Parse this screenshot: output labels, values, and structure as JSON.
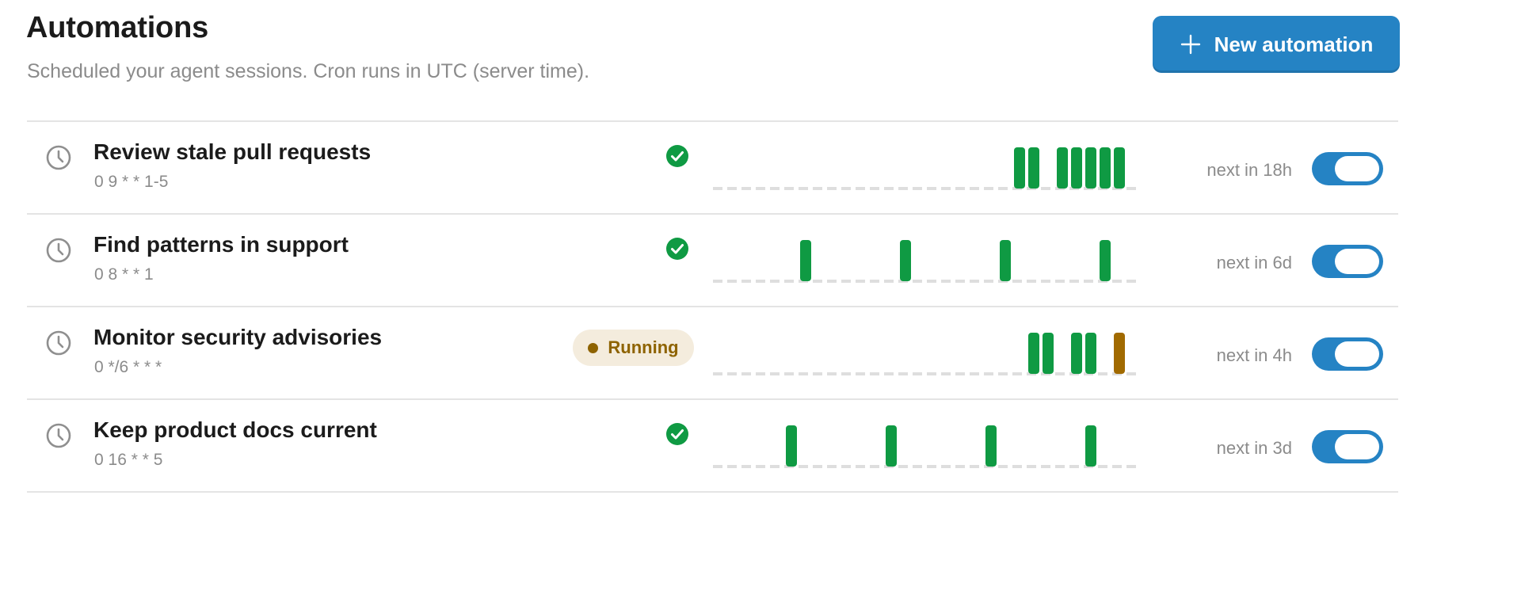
{
  "header": {
    "title": "Automations",
    "subtitle": "Scheduled your agent sessions. Cron runs in UTC (server time).",
    "new_button_label": "New automation"
  },
  "colors": {
    "accent": "#2583c4",
    "success": "#0f9a43",
    "running": "#a16a00",
    "baseline": "#dedede"
  },
  "icons": {
    "row": "clock-icon",
    "status_ok": "check-circle-icon",
    "add": "plus-icon"
  },
  "automations": [
    {
      "name": "Review stale pull requests",
      "cron": "0 9 * * 1-5",
      "status": "success",
      "next_run": "next in 18h",
      "enabled": true,
      "runs": [
        {
          "slot": 21,
          "status": "success"
        },
        {
          "slot": 22,
          "status": "success"
        },
        {
          "slot": 24,
          "status": "success"
        },
        {
          "slot": 25,
          "status": "success"
        },
        {
          "slot": 26,
          "status": "success"
        },
        {
          "slot": 27,
          "status": "success"
        },
        {
          "slot": 28,
          "status": "success"
        }
      ]
    },
    {
      "name": "Find patterns in support",
      "cron": "0 8 * * 1",
      "status": "success",
      "next_run": "next in 6d",
      "enabled": true,
      "runs": [
        {
          "slot": 6,
          "status": "success"
        },
        {
          "slot": 13,
          "status": "success"
        },
        {
          "slot": 20,
          "status": "success"
        },
        {
          "slot": 27,
          "status": "success"
        }
      ]
    },
    {
      "name": "Monitor security advisories",
      "cron": "0 */6 * * *",
      "status": "running",
      "status_label": "Running",
      "next_run": "next in 4h",
      "enabled": true,
      "runs": [
        {
          "slot": 22,
          "status": "success"
        },
        {
          "slot": 23,
          "status": "success"
        },
        {
          "slot": 25,
          "status": "success"
        },
        {
          "slot": 26,
          "status": "success"
        },
        {
          "slot": 28,
          "status": "running"
        }
      ]
    },
    {
      "name": "Keep product docs current",
      "cron": "0 16 * * 5",
      "status": "success",
      "next_run": "next in 3d",
      "enabled": true,
      "runs": [
        {
          "slot": 5,
          "status": "success"
        },
        {
          "slot": 12,
          "status": "success"
        },
        {
          "slot": 19,
          "status": "success"
        },
        {
          "slot": 26,
          "status": "success"
        }
      ]
    }
  ]
}
